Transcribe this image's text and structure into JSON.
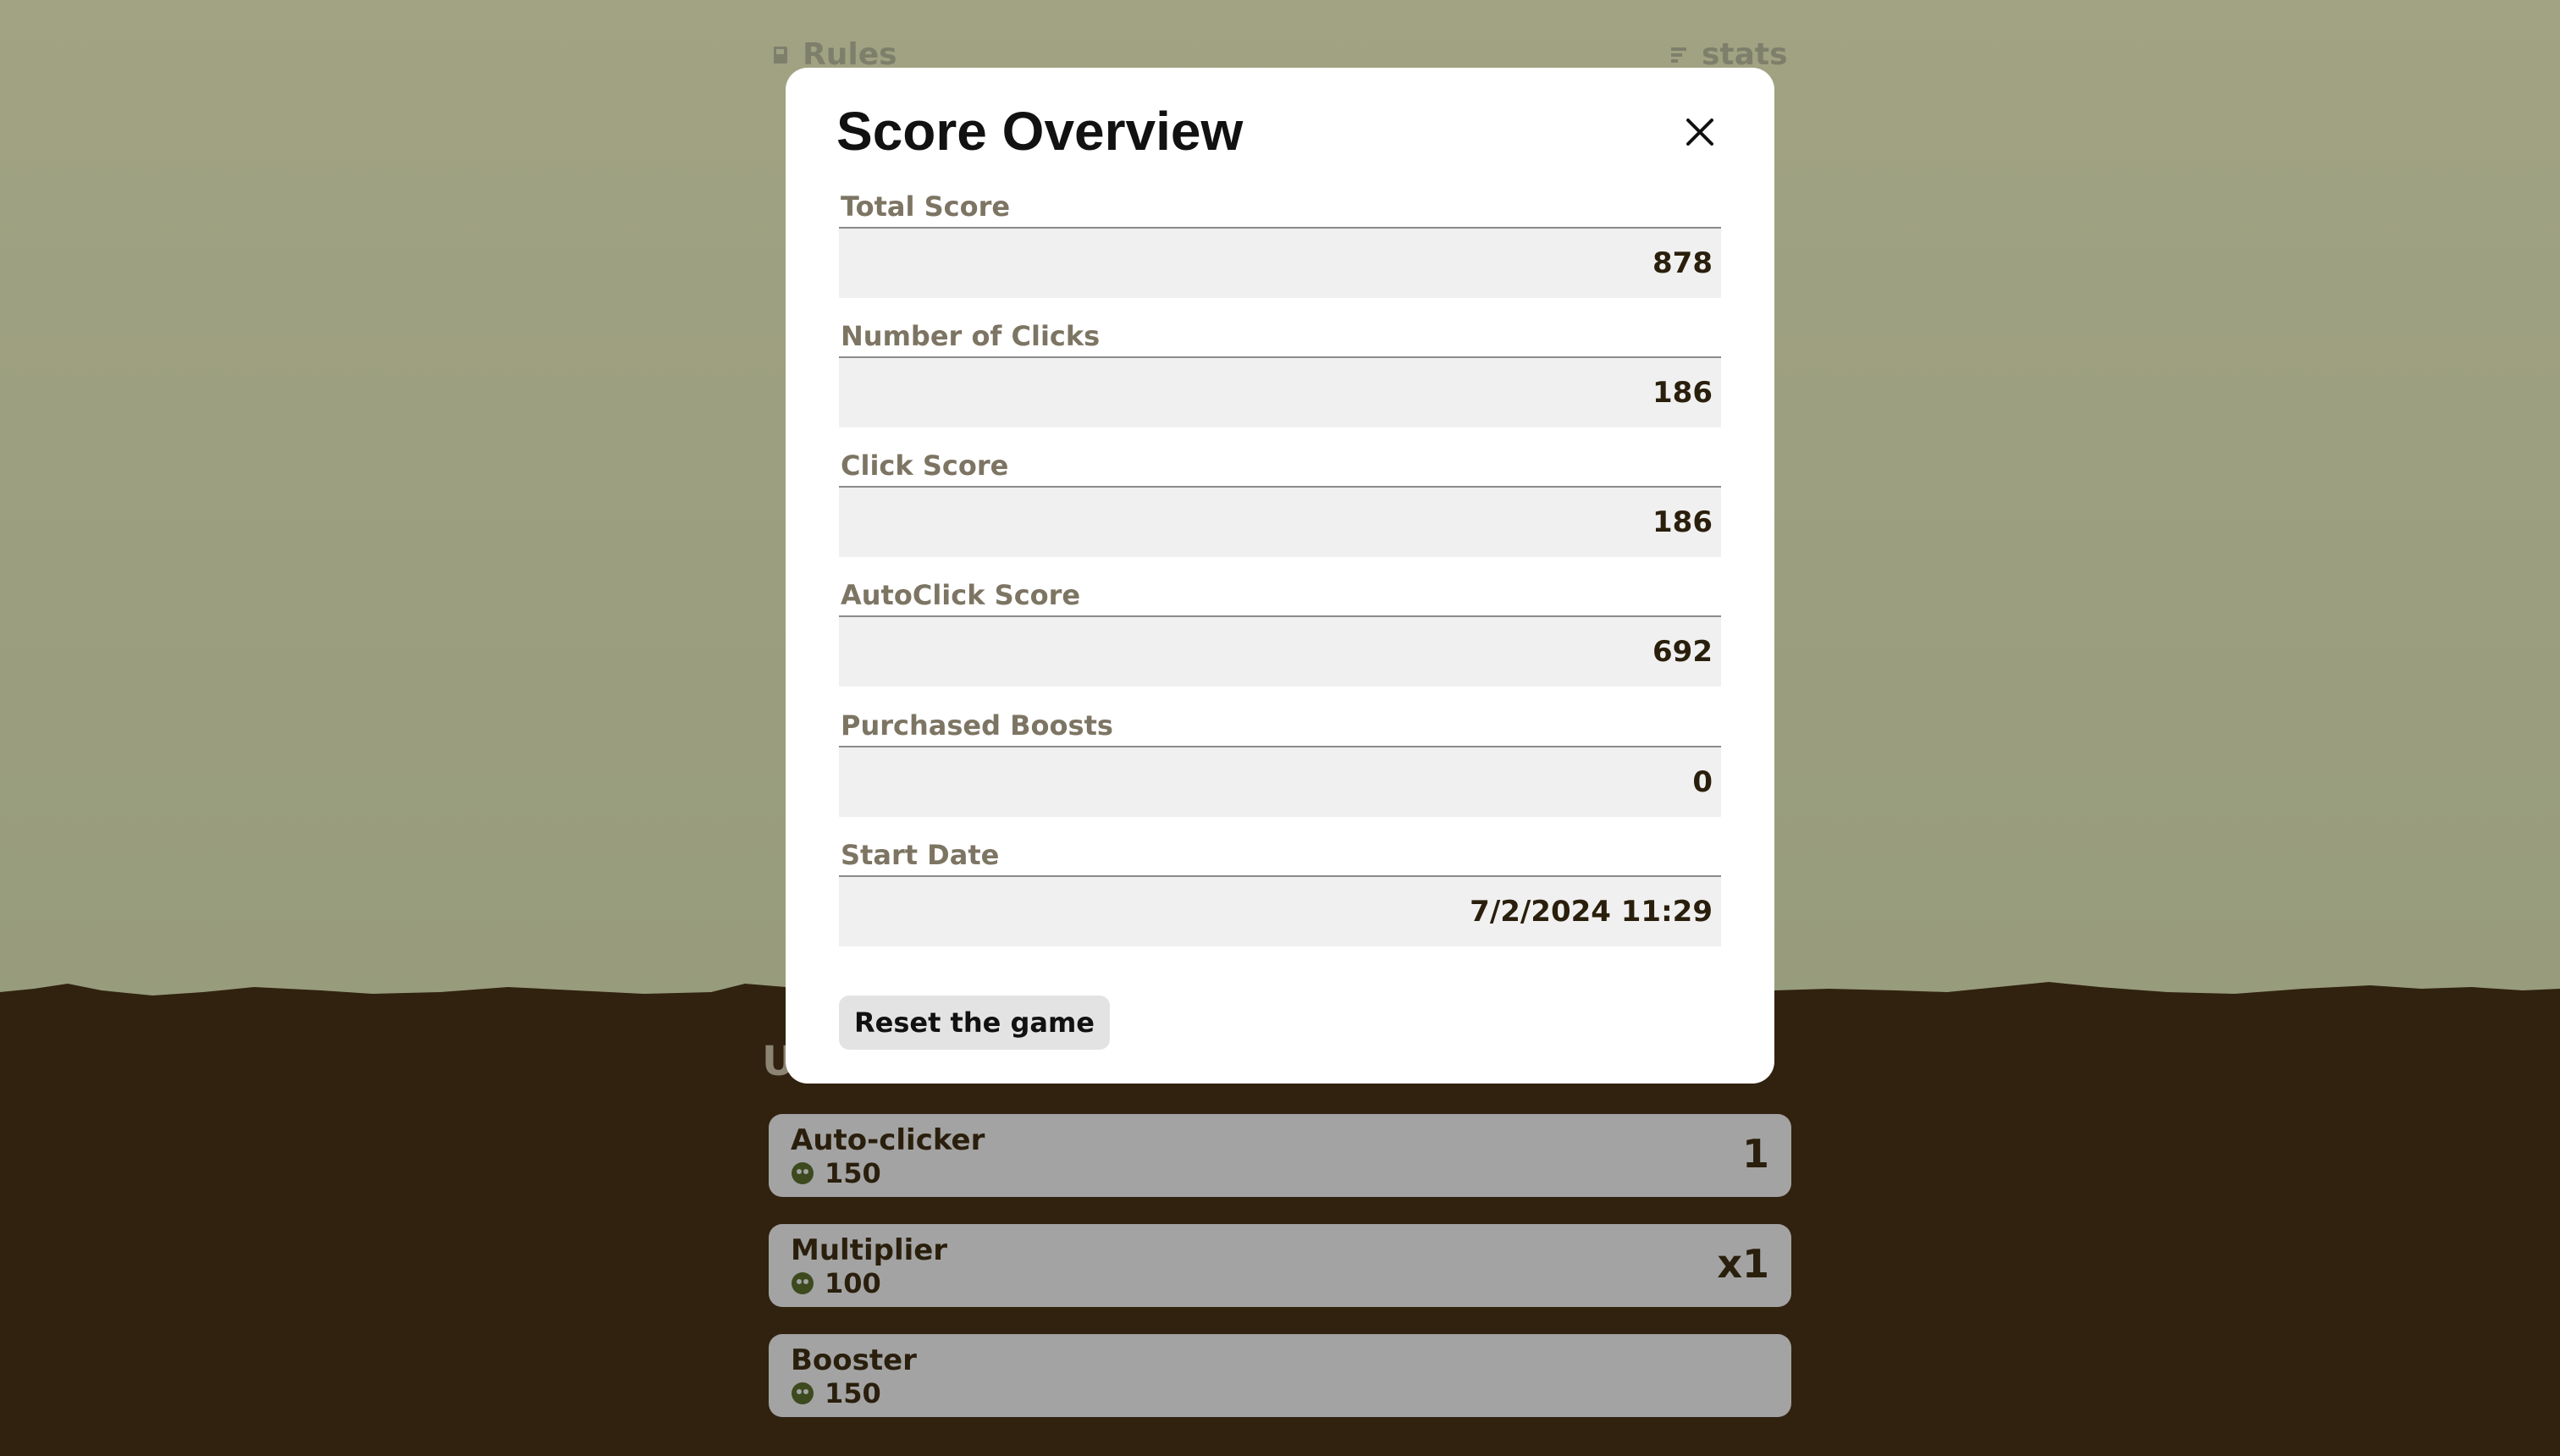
{
  "nav": {
    "rules_label": "Rules",
    "stats_label": "stats"
  },
  "upgrades": {
    "heading": "U",
    "items": [
      {
        "name": "Auto-clicker",
        "cost": "150",
        "level": "1"
      },
      {
        "name": "Multiplier",
        "cost": "100",
        "level": "x1"
      },
      {
        "name": "Booster",
        "cost": "150",
        "level": ""
      }
    ]
  },
  "modal": {
    "title": "Score Overview",
    "fields": [
      {
        "label": "Total Score",
        "value": "878"
      },
      {
        "label": "Number of Clicks",
        "value": "186"
      },
      {
        "label": "Click Score",
        "value": "186"
      },
      {
        "label": "AutoClick Score",
        "value": "692"
      },
      {
        "label": "Purchased Boosts",
        "value": "0"
      },
      {
        "label": "Start Date",
        "value": "7/2/2024 11:29"
      }
    ],
    "reset_label": "Reset the game"
  },
  "colors": {
    "sky": "#9aa07f",
    "ground": "#31220f",
    "card": "#a3a3a3",
    "coin": "#3c4a1e",
    "modal_bg": "#ffffff",
    "field_bg": "#f0f0f0",
    "label": "#7d7563"
  },
  "icons": {
    "rules": "book-icon",
    "stats": "bar-list-icon",
    "close": "close-icon",
    "coin": "coin-icon"
  }
}
